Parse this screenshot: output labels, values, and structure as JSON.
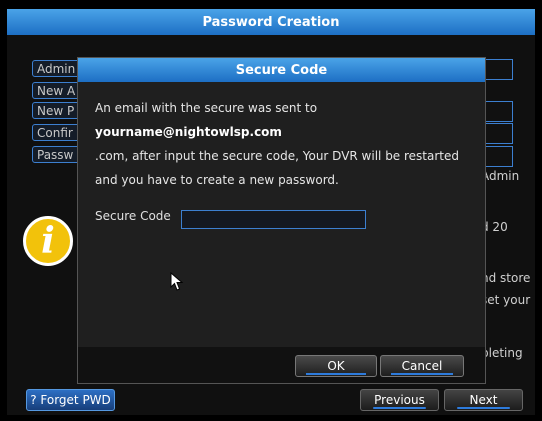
{
  "window": {
    "title": "Password Creation"
  },
  "background_form": {
    "fields": [
      "Admin",
      "New A",
      "New P",
      "Confir",
      "Passw"
    ],
    "right_texts": [
      "Admin",
      "d 20",
      "nd store",
      "set your",
      "pleting"
    ]
  },
  "bottom_bar": {
    "forget_label": "? Forget PWD",
    "previous_label": "Previous",
    "next_label": "Next"
  },
  "dialog": {
    "title": "Secure Code",
    "message_part1": "An email with the secure was sent to ",
    "email": "yourname@nightowlsp.com",
    "message_part2": ".com, after input the secure code, Your DVR will be restarted",
    "message_part3": "and you have to create a new password.",
    "secure_code_label": "Secure Code",
    "secure_code_value": "",
    "ok_label": "OK",
    "cancel_label": "Cancel"
  },
  "colors": {
    "accent": "#1d6fc4",
    "info_icon": "#f2c20b"
  },
  "icons": {
    "info": "info-icon",
    "cursor": "mouse-pointer-icon"
  }
}
